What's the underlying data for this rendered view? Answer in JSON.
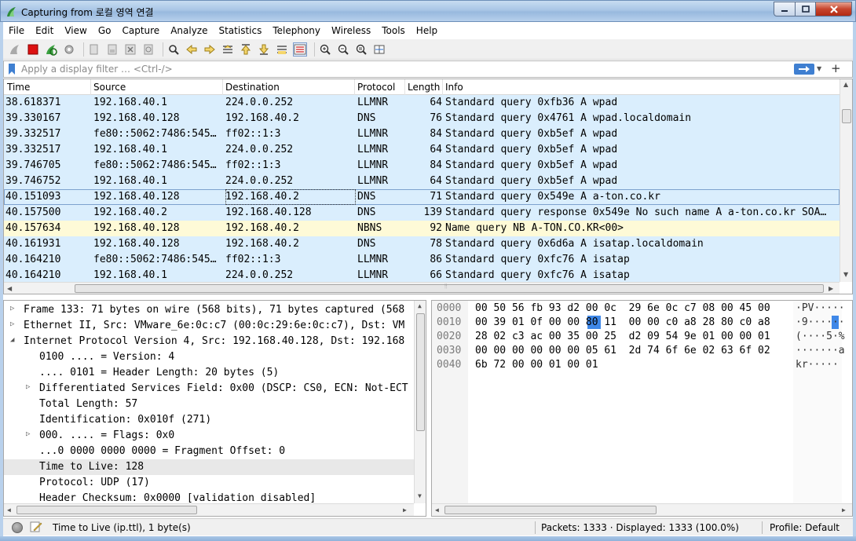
{
  "window": {
    "title": "Capturing from 로컬 영역 연결"
  },
  "menu": [
    "File",
    "Edit",
    "View",
    "Go",
    "Capture",
    "Analyze",
    "Statistics",
    "Telephony",
    "Wireless",
    "Tools",
    "Help"
  ],
  "filter": {
    "placeholder": "Apply a display filter … <Ctrl-/>",
    "value": ""
  },
  "packet_list": {
    "columns": [
      "Time",
      "Source",
      "Destination",
      "Protocol",
      "Length",
      "Info"
    ],
    "rows": [
      {
        "time": "38.618371",
        "src": "192.168.40.1",
        "dst": "224.0.0.252",
        "proto": "LLMNR",
        "len": "64",
        "info": "Standard query 0xfb36 A wpad",
        "bg": "#daeefd"
      },
      {
        "time": "39.330167",
        "src": "192.168.40.128",
        "dst": "192.168.40.2",
        "proto": "DNS",
        "len": "76",
        "info": "Standard query 0x4761 A wpad.localdomain",
        "bg": "#daeefd"
      },
      {
        "time": "39.332517",
        "src": "fe80::5062:7486:545…",
        "dst": "ff02::1:3",
        "proto": "LLMNR",
        "len": "84",
        "info": "Standard query 0xb5ef A wpad",
        "bg": "#daeefd"
      },
      {
        "time": "39.332517",
        "src": "192.168.40.1",
        "dst": "224.0.0.252",
        "proto": "LLMNR",
        "len": "64",
        "info": "Standard query 0xb5ef A wpad",
        "bg": "#daeefd"
      },
      {
        "time": "39.746705",
        "src": "fe80::5062:7486:545…",
        "dst": "ff02::1:3",
        "proto": "LLMNR",
        "len": "84",
        "info": "Standard query 0xb5ef A wpad",
        "bg": "#daeefd"
      },
      {
        "time": "39.746752",
        "src": "192.168.40.1",
        "dst": "224.0.0.252",
        "proto": "LLMNR",
        "len": "64",
        "info": "Standard query 0xb5ef A wpad",
        "bg": "#daeefd"
      },
      {
        "time": "40.151093",
        "src": "192.168.40.128",
        "dst": "192.168.40.2",
        "proto": "DNS",
        "len": "71",
        "info": "Standard query 0x549e A a-ton.co.kr",
        "bg": "#daeefd",
        "selected": true
      },
      {
        "time": "40.157500",
        "src": "192.168.40.2",
        "dst": "192.168.40.128",
        "proto": "DNS",
        "len": "139",
        "info": "Standard query response 0x549e No such name A a-ton.co.kr SOA…",
        "bg": "#daeefd"
      },
      {
        "time": "40.157634",
        "src": "192.168.40.128",
        "dst": "192.168.40.2",
        "proto": "NBNS",
        "len": "92",
        "info": "Name query NB A-TON.CO.KR<00>",
        "bg": "#fefad7"
      },
      {
        "time": "40.161931",
        "src": "192.168.40.128",
        "dst": "192.168.40.2",
        "proto": "DNS",
        "len": "78",
        "info": "Standard query 0x6d6a A isatap.localdomain",
        "bg": "#daeefd"
      },
      {
        "time": "40.164210",
        "src": "fe80::5062:7486:545…",
        "dst": "ff02::1:3",
        "proto": "LLMNR",
        "len": "86",
        "info": "Standard query 0xfc76 A isatap",
        "bg": "#daeefd"
      },
      {
        "time": "40.164210",
        "src": "192.168.40.1",
        "dst": "224.0.0.252",
        "proto": "LLMNR",
        "len": "66",
        "info": "Standard query 0xfc76 A isatap",
        "bg": "#daeefd"
      }
    ]
  },
  "details": [
    {
      "indent": 0,
      "arrow": "right",
      "text": "Frame 133: 71 bytes on wire (568 bits), 71 bytes captured (568"
    },
    {
      "indent": 0,
      "arrow": "right",
      "text": "Ethernet II, Src: VMware_6e:0c:c7 (00:0c:29:6e:0c:c7), Dst: VM"
    },
    {
      "indent": 0,
      "arrow": "down",
      "text": "Internet Protocol Version 4, Src: 192.168.40.128, Dst: 192.168"
    },
    {
      "indent": 1,
      "arrow": "",
      "text": "0100 .... = Version: 4"
    },
    {
      "indent": 1,
      "arrow": "",
      "text": ".... 0101 = Header Length: 20 bytes (5)"
    },
    {
      "indent": 1,
      "arrow": "right",
      "text": "Differentiated Services Field: 0x00 (DSCP: CS0, ECN: Not-ECT"
    },
    {
      "indent": 1,
      "arrow": "",
      "text": "Total Length: 57"
    },
    {
      "indent": 1,
      "arrow": "",
      "text": "Identification: 0x010f (271)"
    },
    {
      "indent": 1,
      "arrow": "right",
      "text": "000. .... = Flags: 0x0"
    },
    {
      "indent": 1,
      "arrow": "",
      "text": "...0 0000 0000 0000 = Fragment Offset: 0"
    },
    {
      "indent": 1,
      "arrow": "",
      "text": "Time to Live: 128",
      "selected": true
    },
    {
      "indent": 1,
      "arrow": "",
      "text": "Protocol: UDP (17)"
    },
    {
      "indent": 1,
      "arrow": "",
      "text": "Header Checksum: 0x0000 [validation disabled]"
    }
  ],
  "bytes": {
    "offsets": [
      "0000",
      "0010",
      "0020",
      "0030",
      "0040"
    ],
    "hex": [
      "00 50 56 fb 93 d2 00 0c  29 6e 0c c7 08 00 45 00",
      "00 39 01 0f 00 00 80 11  00 00 c0 a8 28 80 c0 a8",
      "28 02 c3 ac 00 35 00 25  d2 09 54 9e 01 00 00 01",
      "00 00 00 00 00 00 05 61  2d 74 6f 6e 02 63 6f 02",
      "6b 72 00 00 01 00 01"
    ],
    "ascii": [
      "·PV·····",
      "·9······",
      "(····5·%",
      "·······a",
      "kr·····"
    ],
    "highlight_byte": "80"
  },
  "status": {
    "field_info": "Time to Live (ip.ttl), 1 byte(s)",
    "packets": "Packets: 1333 · Displayed: 1333 (100.0%)",
    "profile": "Profile: Default"
  },
  "colors": {
    "row_default": "#daeefd",
    "row_nbns": "#fefad7",
    "selection": "#3f88e8"
  }
}
